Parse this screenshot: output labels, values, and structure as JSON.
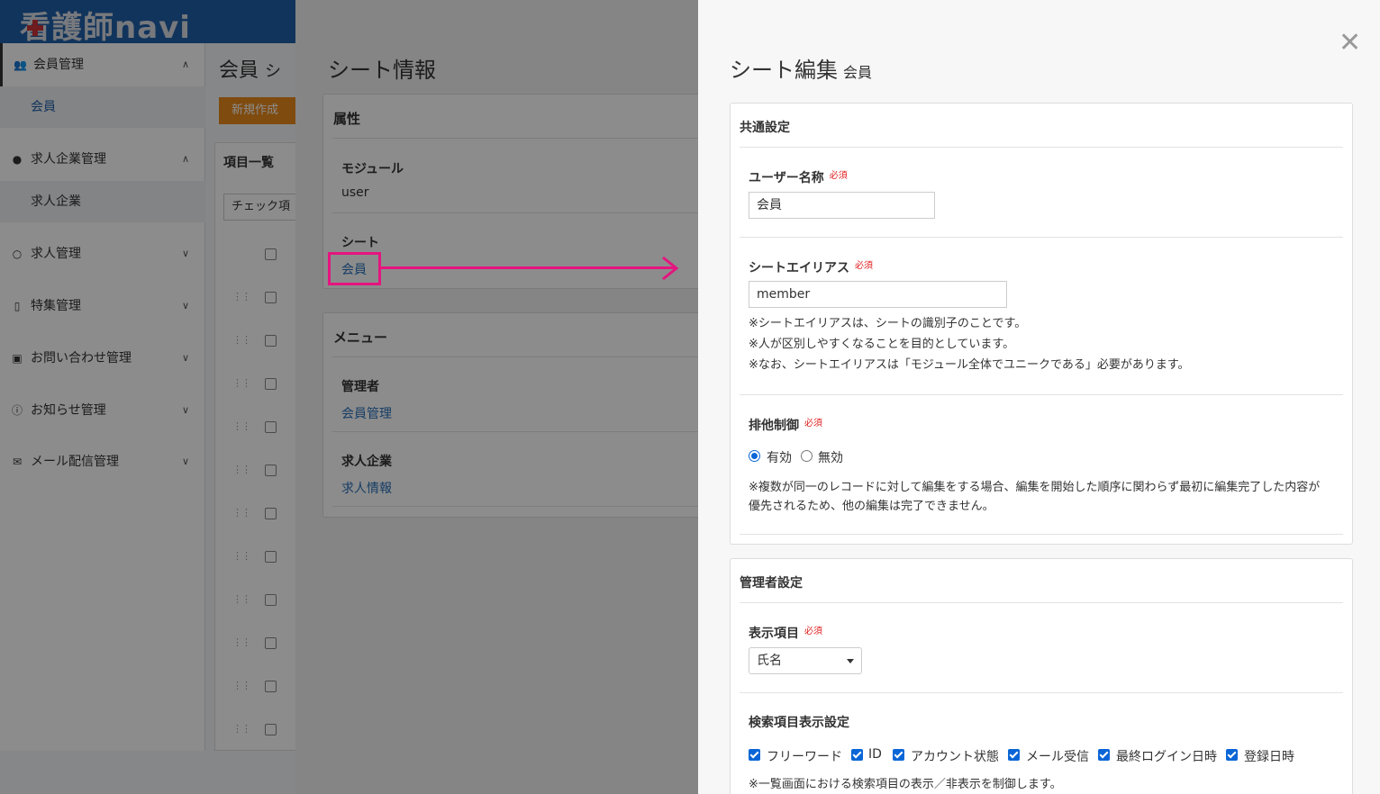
{
  "app": {
    "logo": "看護師navi",
    "page_title": "会員",
    "page_title_suffix": "シ",
    "new_button": "新規作成",
    "list_header": "項目一覧",
    "check_select": "チェック項"
  },
  "sidebar": {
    "groups": [
      {
        "label": "会員管理",
        "icon": "users-icon",
        "sub": [
          "会員"
        ]
      },
      {
        "label": "求人企業管理",
        "icon": "user-icon",
        "sub": [
          "求人企業"
        ]
      },
      {
        "label": "求人管理",
        "icon": "user-outline-icon"
      },
      {
        "label": "特集管理",
        "icon": "file-icon"
      },
      {
        "label": "お問い合わせ管理",
        "icon": "inbox-icon"
      },
      {
        "label": "お知らせ管理",
        "icon": "info-icon"
      },
      {
        "label": "メール配信管理",
        "icon": "mail-icon"
      }
    ]
  },
  "info": {
    "title": "シート情報",
    "attributes": {
      "title": "属性",
      "module_label": "モジュール",
      "module_value": "user",
      "sheet_label": "シート",
      "sheet_value": "会員"
    },
    "menu": {
      "title": "メニュー",
      "admin_label": "管理者",
      "admin_link": "会員管理",
      "company_label": "求人企業",
      "company_link": "求人情報"
    }
  },
  "drawer": {
    "title": "シート編集",
    "subtitle": "会員",
    "close_icon": "close-icon",
    "common": {
      "title": "共通設定",
      "username_label": "ユーザー名称",
      "required": "必須",
      "username_value": "会員",
      "alias_label": "シートエイリアス",
      "alias_value": "member",
      "alias_notes": [
        "※シートエイリアスは、シートの識別子のことです。",
        "※人が区別しやすくなることを目的としています。",
        "※なお、シートエイリアスは「モジュール全体でユニークである」必要があります。"
      ],
      "lock_label": "排他制御",
      "lock_options": [
        "有効",
        "無効"
      ],
      "lock_selected": "有効",
      "lock_notes": [
        "※複数が同一のレコードに対して編集をする場合、編集を開始した順序に関わらず最初に編集完了した内容が",
        "優先されるため、他の編集は完了できません。"
      ]
    },
    "admin": {
      "title": "管理者設定",
      "display_label": "表示項目",
      "display_value": "氏名",
      "search_label": "検索項目表示設定",
      "search_items": [
        "フリーワード",
        "ID",
        "アカウント状態",
        "メール受信",
        "最終ログイン日時",
        "登録日時"
      ],
      "search_note": "※一覧画面における検索項目の表示／非表示を制御します。"
    }
  },
  "colors": {
    "accent": "#0a66d6",
    "highlight": "#e5157f",
    "required": "#e02020",
    "link": "#2a6fb8"
  }
}
